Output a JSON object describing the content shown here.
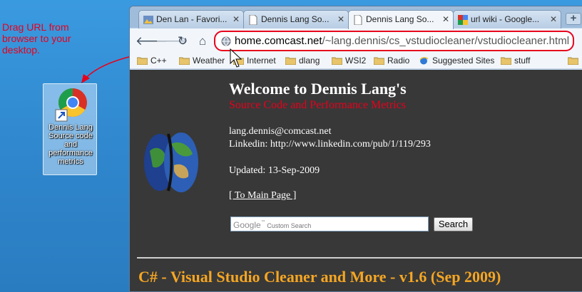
{
  "desktop": {
    "annotation": "Drag URL from browser to your desktop.",
    "shortcut": {
      "label": "Dennis Lang Source code and performance metrics",
      "icon": "chrome-shortcut-icon"
    }
  },
  "browser": {
    "tabs": [
      {
        "label": "Den Lan - Favori...",
        "icon": "photo-favicon"
      },
      {
        "label": "Dennis Lang So...",
        "icon": "page-favicon"
      },
      {
        "label": "Dennis Lang So...",
        "icon": "page-favicon",
        "active": true
      },
      {
        "label": "url wiki - Google...",
        "icon": "google-favicon"
      }
    ],
    "new_tab_label": "+",
    "omnibox": {
      "host": "home.comcast.net",
      "path": "/~lang.dennis/cs_vstudiocleaner/vstudiocleaner.html"
    },
    "bookmarks": [
      "C++",
      "Weather",
      "Internet",
      "dlang",
      "WSI2",
      "Radio",
      "Suggested Sites",
      "stuff"
    ]
  },
  "page": {
    "title": "Welcome to Dennis Lang's",
    "subtitle": "Source Code and Performance Metrics",
    "email": "lang.dennis@comcast.net",
    "linkedin": "Linkedin: http://www.linkedin.com/pub/1/119/293",
    "updated": "Updated: 13-Sep-2009",
    "main_link": "[ To Main Page ]",
    "search_placeholder_brand": "Google",
    "search_placeholder": "Custom Search",
    "search_button": "Search",
    "section_title": "C# - Visual Studio Cleaner and More - v1.6 (Sep 2009)"
  },
  "colors": {
    "annotation": "#e8001c",
    "subtitle": "#e8001c",
    "section_title": "#f5a623",
    "page_bg": "#383838"
  }
}
